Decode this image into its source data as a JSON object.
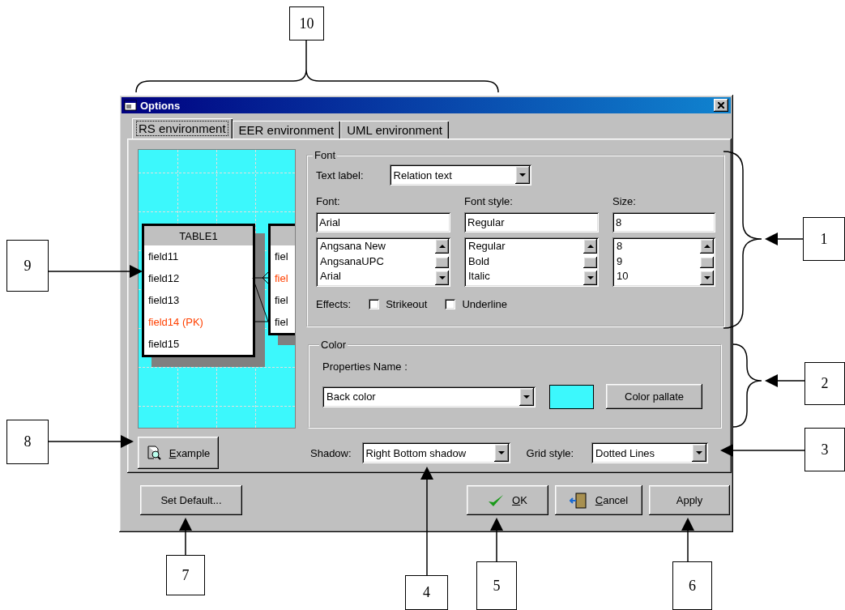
{
  "window": {
    "title": "Options"
  },
  "tabs": [
    {
      "label": "RS environment",
      "selected": true
    },
    {
      "label": "EER environment",
      "selected": false
    },
    {
      "label": "UML environment",
      "selected": false
    }
  ],
  "preview": {
    "tables": [
      {
        "title": "TABLE1",
        "fields": [
          {
            "name": "field11",
            "primary_key": false
          },
          {
            "name": "field12",
            "primary_key": false
          },
          {
            "name": "field13",
            "primary_key": false
          },
          {
            "name": "field14  (PK)",
            "primary_key": true
          },
          {
            "name": "field15",
            "primary_key": false
          }
        ]
      },
      {
        "fields": [
          {
            "name": "fiel",
            "primary_key": false
          },
          {
            "name": "fiel",
            "primary_key": true
          },
          {
            "name": "fiel",
            "primary_key": false
          },
          {
            "name": "fiel",
            "primary_key": false
          }
        ]
      }
    ]
  },
  "font_group": {
    "title": "Font",
    "text_label": {
      "label": "Text label:",
      "value": "Relation text"
    },
    "columns": [
      {
        "label": "Font:",
        "value": "Arial",
        "options": [
          "Angsana New",
          "AngsanaUPC",
          "Arial"
        ]
      },
      {
        "label": "Font style:",
        "value": "Regular",
        "options": [
          "Regular",
          "Bold",
          "Italic"
        ]
      },
      {
        "label": "Size:",
        "value": "8",
        "options": [
          "8",
          "9",
          "10"
        ]
      }
    ],
    "effects": {
      "label": "Effects:",
      "checkboxes": [
        {
          "label": "Strikeout",
          "checked": false
        },
        {
          "label": "Underline",
          "checked": false
        }
      ]
    }
  },
  "color_group": {
    "title": "Color",
    "properties_label": "Properties Name :",
    "property": "Back color",
    "swatch": {
      "color": "#3cf8fc"
    },
    "button": "Color pallate"
  },
  "example_button": "Example",
  "shadow": {
    "label": "Shadow:",
    "value": "Right Bottom shadow"
  },
  "grid_style": {
    "label": "Grid style:",
    "value": "Dotted Lines"
  },
  "buttons": [
    {
      "label": "Set Default...",
      "kind": "plain"
    },
    {
      "label": "OK",
      "kind": "ok"
    },
    {
      "label": "Cancel",
      "kind": "cancel"
    },
    {
      "label": "Apply",
      "kind": "plain"
    }
  ],
  "callouts": [
    "10",
    "1",
    "2",
    "3",
    "4",
    "5",
    "6",
    "7",
    "8",
    "9"
  ]
}
